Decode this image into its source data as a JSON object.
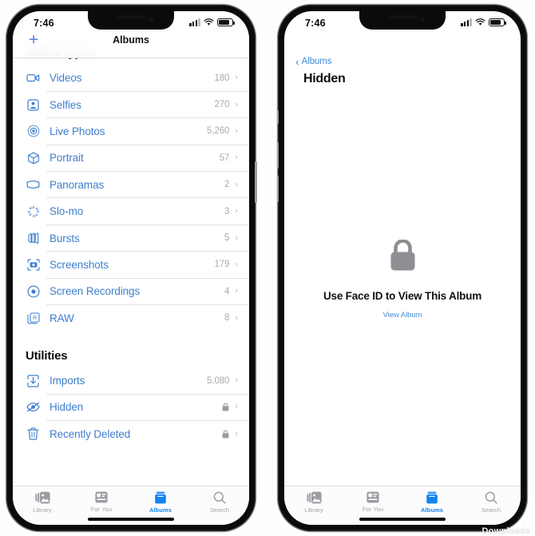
{
  "accent": {
    "link_blue": "#3f7fce",
    "nav_blue": "#4a88cf",
    "tab_active_blue": "#1383ef",
    "count_gray": "#a9abae",
    "lock_gray": "#8d8f93"
  },
  "left_phone": {
    "status_bar": {
      "time": "7:46",
      "cellular_icon": "cellular-bars-icon",
      "wifi_icon": "wifi-icon",
      "battery_icon": "battery-icon"
    },
    "nav": {
      "add_label": "+",
      "add_icon": "plus-icon",
      "title": "Albums"
    },
    "sections": [
      {
        "header": "Media Types",
        "rows": [
          {
            "icon": "video-camera-icon",
            "label": "Videos",
            "count": "180",
            "locked": false
          },
          {
            "icon": "selfie-person-icon",
            "label": "Selfies",
            "count": "270",
            "locked": false
          },
          {
            "icon": "live-photo-icon",
            "label": "Live Photos",
            "count": "5,260",
            "locked": false
          },
          {
            "icon": "portrait-cube-icon",
            "label": "Portrait",
            "count": "57",
            "locked": false
          },
          {
            "icon": "panorama-icon",
            "label": "Panoramas",
            "count": "2",
            "locked": false
          },
          {
            "icon": "slo-mo-icon",
            "label": "Slo-mo",
            "count": "3",
            "locked": false
          },
          {
            "icon": "bursts-icon",
            "label": "Bursts",
            "count": "5",
            "locked": false
          },
          {
            "icon": "screenshot-icon",
            "label": "Screenshots",
            "count": "179",
            "locked": false
          },
          {
            "icon": "screen-recording-icon",
            "label": "Screen Recordings",
            "count": "4",
            "locked": false
          },
          {
            "icon": "raw-icon",
            "label": "RAW",
            "count": "8",
            "locked": false
          }
        ]
      },
      {
        "header": "Utilities",
        "rows": [
          {
            "icon": "import-icon",
            "label": "Imports",
            "count": "5,080",
            "locked": false
          },
          {
            "icon": "hidden-eye-icon",
            "label": "Hidden",
            "count": "",
            "locked": true
          },
          {
            "icon": "trash-icon",
            "label": "Recently Deleted",
            "count": "",
            "locked": true
          }
        ]
      }
    ],
    "tabs": [
      {
        "icon": "library-photos-icon",
        "label": "Library",
        "active": false
      },
      {
        "icon": "for-you-card-icon",
        "label": "For You",
        "active": false
      },
      {
        "icon": "albums-book-icon",
        "label": "Albums",
        "active": true
      },
      {
        "icon": "search-magnifier-icon",
        "label": "Search",
        "active": false
      }
    ]
  },
  "right_phone": {
    "status_bar": {
      "time": "7:46",
      "cellular_icon": "cellular-bars-icon",
      "wifi_icon": "wifi-icon",
      "battery_icon": "battery-icon"
    },
    "nav": {
      "back_chevron": "‹",
      "back_label": "Albums",
      "large_title": "Hidden"
    },
    "locked_state": {
      "lock_icon": "lock-closed-icon",
      "title": "Use Face ID to View This Album",
      "link": "View Album"
    },
    "tabs": [
      {
        "icon": "library-photos-icon",
        "label": "Library",
        "active": false
      },
      {
        "icon": "for-you-card-icon",
        "label": "For You",
        "active": false
      },
      {
        "icon": "albums-book-icon",
        "label": "Albums",
        "active": true
      },
      {
        "icon": "search-magnifier-icon",
        "label": "Search",
        "active": false
      }
    ]
  },
  "watermark": {
    "text": "Downloads"
  }
}
